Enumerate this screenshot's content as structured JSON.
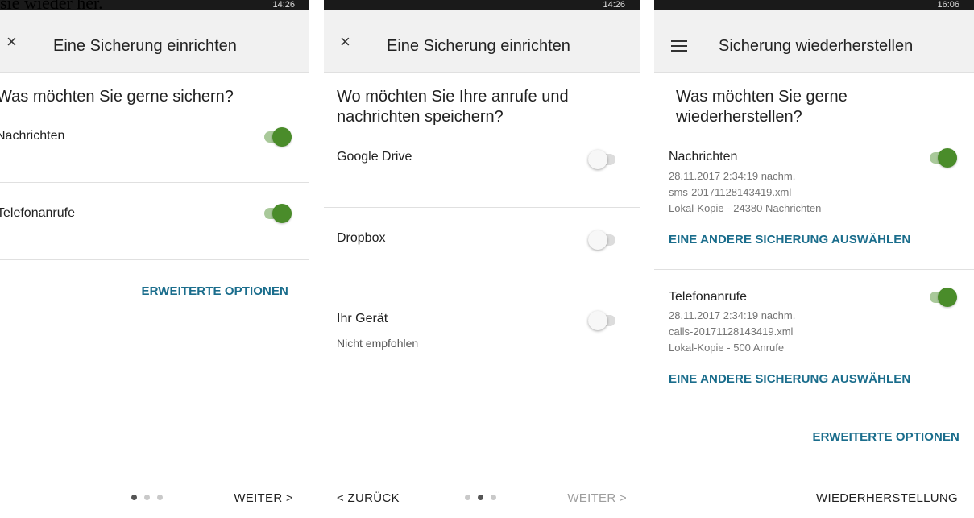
{
  "caption": "sie wieder her.",
  "screens": [
    {
      "status_time": "14:26",
      "nav_icon": "close-icon",
      "nav_glyph": "×",
      "title": "Eine Sicherung einrichten",
      "question": "Was möchten Sie gerne sichern?",
      "options": [
        {
          "label": "Nachrichten",
          "toggle": "on"
        },
        {
          "label": "Telefonanrufe",
          "toggle": "on"
        }
      ],
      "advanced_link": "ERWEITERTE OPTIONEN",
      "footer": {
        "next_label": "WEITER >",
        "page_indicator": {
          "total": 3,
          "current": 1
        }
      }
    },
    {
      "status_time": "14:26",
      "nav_icon": "close-icon",
      "nav_glyph": "×",
      "title": "Eine Sicherung einrichten",
      "question": "Wo möchten Sie Ihre anrufe und nachrichten speichern?",
      "options": [
        {
          "label": "Google Drive",
          "toggle": "off"
        },
        {
          "label": "Dropbox",
          "toggle": "off"
        },
        {
          "label": "Ihr Gerät",
          "sublabel": "Nicht empfohlen",
          "toggle": "off"
        }
      ],
      "footer": {
        "back_label": "< ZURÜCK",
        "next_label": "WEITER >",
        "next_enabled": false,
        "page_indicator": {
          "total": 3,
          "current": 2
        }
      }
    },
    {
      "status_time": "16:06",
      "nav_icon": "menu-icon",
      "title": "Sicherung wiederherstellen",
      "question": "Was möchten Sie gerne wiederherstellen?",
      "items": [
        {
          "label": "Nachrichten",
          "toggle": "on",
          "date": "28.11.2017 2:34:19 nachm.",
          "file": "sms-20171128143419.xml",
          "summary": "Lokal-Kopie - 24380 Nachrichten",
          "select_link": "EINE ANDERE SICHERUNG AUSWÄHLEN"
        },
        {
          "label": "Telefonanrufe",
          "toggle": "on",
          "date": "28.11.2017 2:34:19 nachm.",
          "file": "calls-20171128143419.xml",
          "summary": "Lokal-Kopie - 500 Anrufe",
          "select_link": "EINE ANDERE SICHERUNG AUSWÄHLEN"
        }
      ],
      "advanced_link": "ERWEITERTE OPTIONEN",
      "footer": {
        "restore_label": "WIEDERHERSTELLUNG"
      }
    }
  ],
  "colors": {
    "accent_link": "#1a6d8c",
    "toggle_on_thumb": "#4a8c2a",
    "toggle_on_track": "#a9c99a",
    "appbar_bg": "#f1f1f1"
  }
}
